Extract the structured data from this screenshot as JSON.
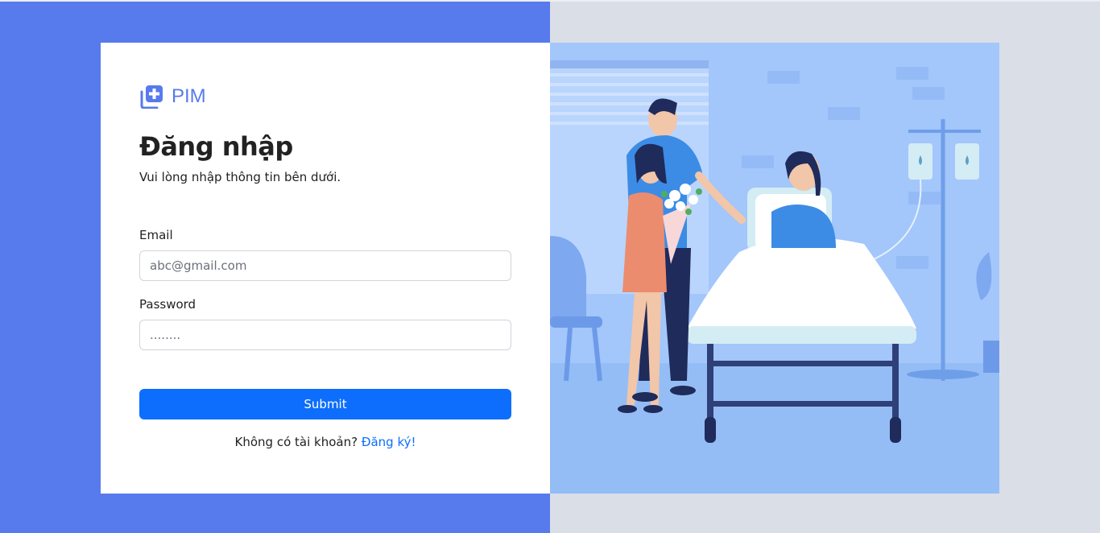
{
  "brand": {
    "name": "PIM",
    "icon": "medical-plus-icon"
  },
  "login": {
    "title": "Đăng nhập",
    "subtitle": "Vui lòng nhập thông tin bên dưới."
  },
  "form": {
    "email_label": "Email",
    "email_placeholder": "abc@gmail.com",
    "password_label": "Password",
    "password_placeholder": "........",
    "submit_label": "Submit"
  },
  "footer": {
    "prompt": "Không có tài khoản?",
    "register_link": "Đăng ký!"
  },
  "colors": {
    "accent": "#577aec",
    "button": "#0d6efd",
    "illustration_bg": "#a3c6fb",
    "right_bg": "#dadee6"
  },
  "illustration": {
    "icon": "hospital-visit-illustration"
  }
}
